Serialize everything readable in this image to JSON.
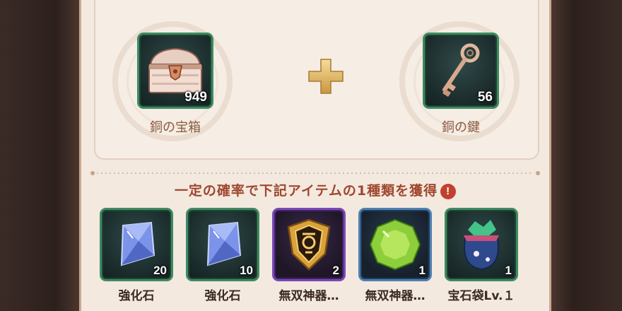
{
  "recipe": {
    "chest": {
      "name": "銅の宝箱",
      "quantity": "949",
      "icon": "treasure-chest-icon"
    },
    "key": {
      "name": "銅の鍵",
      "quantity": "56",
      "icon": "key-icon"
    },
    "combine_icon": "plus-icon"
  },
  "rewards_heading": "一定の確率で下記アイテムの1種類を獲得",
  "info_icon": "exclamation-icon",
  "rewards": [
    {
      "name": "強化石",
      "quantity": "20",
      "icon": "blue-crystal-icon",
      "rarity_color": "#3f8a62"
    },
    {
      "name": "強化石",
      "quantity": "10",
      "icon": "blue-crystal-icon",
      "rarity_color": "#3f8a62"
    },
    {
      "name": "無双神器…",
      "quantity": "2",
      "icon": "golden-emblem-icon",
      "rarity_color": "#7b48b8"
    },
    {
      "name": "無双神器…",
      "quantity": "1",
      "icon": "green-gem-icon",
      "rarity_color": "#4f7fb0"
    },
    {
      "name": "宝石袋Lv.１",
      "quantity": "1",
      "icon": "gem-pouch-icon",
      "rarity_color": "#3f8a62"
    }
  ],
  "colors": {
    "panel": "#f4e9df",
    "heading": "#a0472f",
    "label": "#8a5a3c"
  }
}
